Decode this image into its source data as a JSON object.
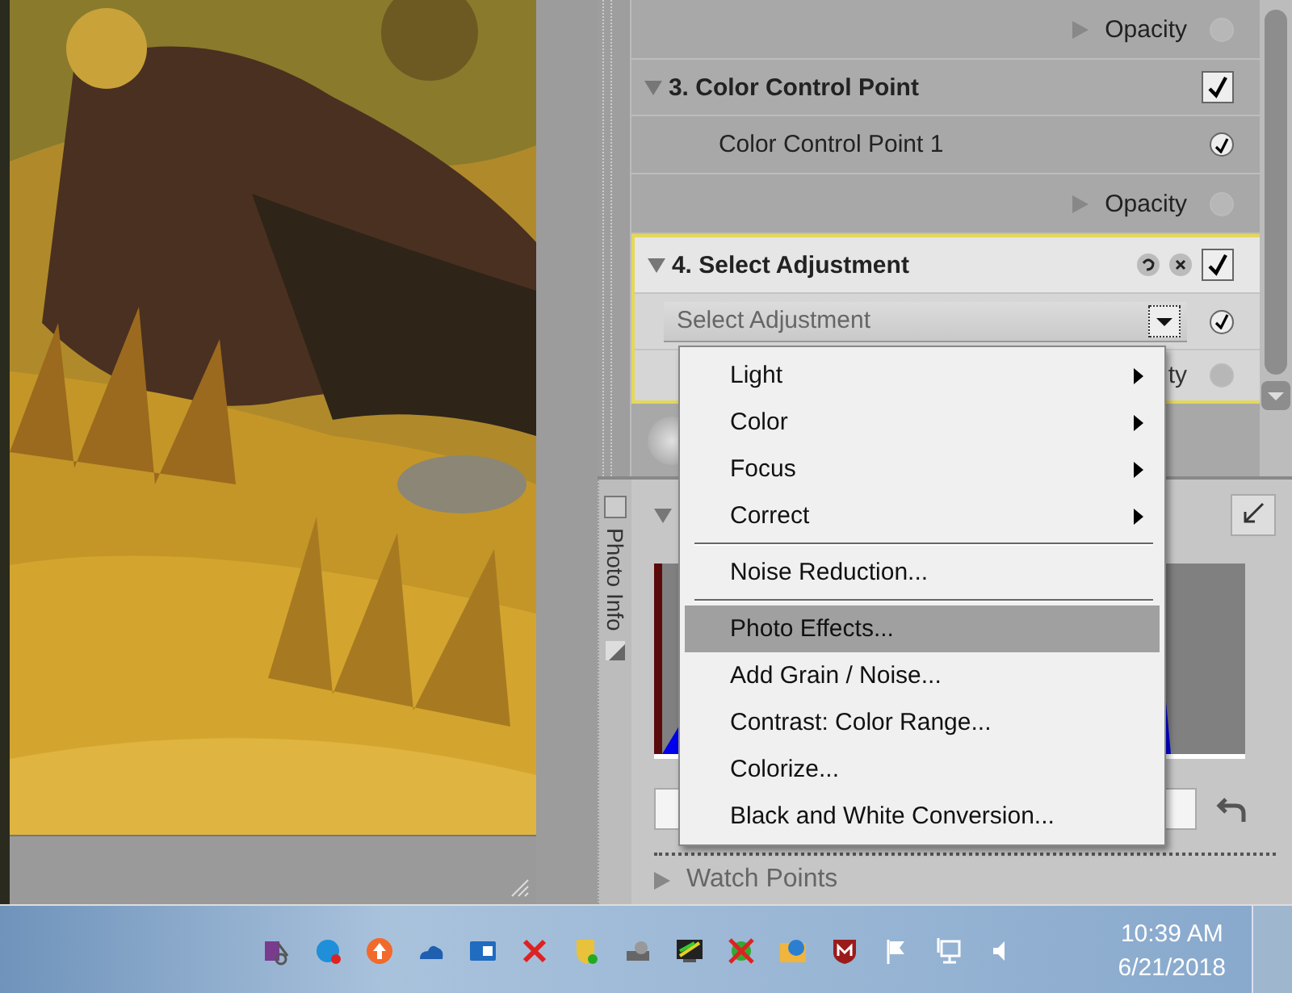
{
  "panel": {
    "rows": [
      {
        "kind": "opacity",
        "label": "Opacity",
        "checked": false
      },
      {
        "kind": "header",
        "label": "3. Color Control Point",
        "checked": true
      },
      {
        "kind": "item",
        "label": "Color Control Point 1",
        "checked": true
      },
      {
        "kind": "opacity",
        "label": "Opacity",
        "checked": false
      }
    ],
    "active_section": {
      "title": "4. Select Adjustment",
      "checked": true,
      "dropdown": {
        "value": "Select Adjustment",
        "checked": true
      },
      "partial_row": {
        "label": "ty",
        "checked": false
      }
    }
  },
  "menu": {
    "items": [
      {
        "kind": "submenu",
        "label": "Light",
        "selected": false
      },
      {
        "kind": "submenu",
        "label": "Color",
        "selected": false
      },
      {
        "kind": "submenu",
        "label": "Focus",
        "selected": false
      },
      {
        "kind": "submenu",
        "label": "Correct",
        "selected": false
      },
      {
        "kind": "separator"
      },
      {
        "kind": "item",
        "label": "Noise Reduction...",
        "selected": false
      },
      {
        "kind": "separator"
      },
      {
        "kind": "item",
        "label": "Photo Effects...",
        "selected": true
      },
      {
        "kind": "item",
        "label": "Add Grain / Noise...",
        "selected": false
      },
      {
        "kind": "item",
        "label": "Contrast: Color Range...",
        "selected": false
      },
      {
        "kind": "item",
        "label": "Colorize...",
        "selected": false
      },
      {
        "kind": "item",
        "label": "Black and White Conversion...",
        "selected": false
      }
    ]
  },
  "photo_info": {
    "title": "Photo Info"
  },
  "watch_points": {
    "label": "Watch Points"
  },
  "taskbar": {
    "time": "10:39 AM",
    "date": "6/21/2018"
  }
}
